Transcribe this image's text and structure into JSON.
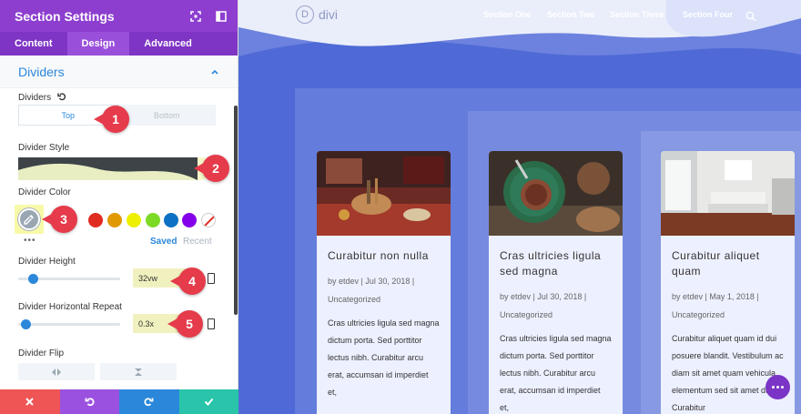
{
  "panel": {
    "title": "Section Settings",
    "tabs": [
      "Content",
      "Design",
      "Advanced"
    ],
    "active_tab": "Design",
    "section_title": "Dividers",
    "dividers_label": "Dividers",
    "placement_options": [
      "Top",
      "Bottom"
    ],
    "placement_selected": "Top",
    "style_label": "Divider Style",
    "color_label": "Divider Color",
    "color_swatches": [
      "#e02b20",
      "#e09900",
      "#edf000",
      "#7cda24",
      "#0c71c3",
      "#8300e9"
    ],
    "saved_label": "Saved",
    "recent_label": "Recent",
    "height_label": "Divider Height",
    "height_value": "32vw",
    "height_slider_fraction": 0.1,
    "repeat_label": "Divider Horizontal Repeat",
    "repeat_value": "0.3x",
    "repeat_slider_fraction": 0.03,
    "flip_label": "Divider Flip",
    "accent_color": "#8d3ecf",
    "link_color": "#2b87da"
  },
  "callouts": [
    "1",
    "2",
    "3",
    "4",
    "5"
  ],
  "footer": {
    "buttons": [
      {
        "name": "close-icon",
        "color": "#ef5555"
      },
      {
        "name": "undo-icon",
        "color": "#9b51e0"
      },
      {
        "name": "redo-icon",
        "color": "#2b87da"
      },
      {
        "name": "check-icon",
        "color": "#29c4a9"
      }
    ]
  },
  "site": {
    "logo_letter": "D",
    "logo_text": "divi",
    "nav": [
      "Section One",
      "Section Two",
      "Section Three",
      "Section Four"
    ],
    "background_color": "#4f6ad6",
    "cards": [
      {
        "title": "Curabitur non nulla",
        "meta": "by etdev | Jul 30, 2018 | Uncategorized",
        "excerpt": "Cras ultricies ligula sed magna dictum porta. Sed porttitor lectus nibh. Curabitur arcu erat, accumsan id imperdiet et,"
      },
      {
        "title": "Cras ultricies ligula sed magna",
        "meta": "by etdev | Jul 30, 2018 | Uncategorized",
        "excerpt": "Cras ultricies ligula sed magna dictum porta. Sed porttitor lectus nibh. Curabitur arcu erat, accumsan id imperdiet et,"
      },
      {
        "title": "Curabitur aliquet quam",
        "meta": "by etdev | May 1, 2018 | Uncategorized",
        "excerpt": "Curabitur aliquet quam id dui posuere blandit. Vestibulum ac diam sit amet quam vehicula elementum sed sit amet dui. Curabitur"
      }
    ]
  }
}
